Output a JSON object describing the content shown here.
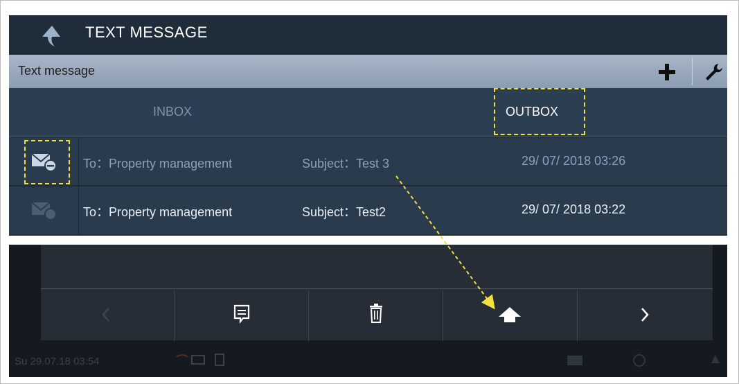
{
  "header": {
    "title": "TEXT MESSAGE"
  },
  "subbar": {
    "label": "Text message"
  },
  "tabs": [
    {
      "label": "INBOX",
      "active": false
    },
    {
      "label": "OUTBOX",
      "active": true
    }
  ],
  "messages": [
    {
      "to": "To：Property management",
      "subject": "Subject：Test 3",
      "datetime": "29/ 07/ 2018 03:26",
      "icon": "envelope-minus-icon"
    },
    {
      "to": "To：Property management",
      "subject": "Subject：Test2",
      "datetime": "29/ 07/ 2018 03:22",
      "icon": "envelope-check-icon"
    }
  ],
  "toolbar": {
    "buttons": [
      "prev-icon",
      "message-icon",
      "trash-icon",
      "home-icon",
      "next-icon"
    ]
  },
  "status": {
    "datetime": "Su 29.07.18  03:54"
  },
  "colors": {
    "highlight": "#f0e23a",
    "panel": "#1f2d3b",
    "subbar": "#9aaabf"
  }
}
